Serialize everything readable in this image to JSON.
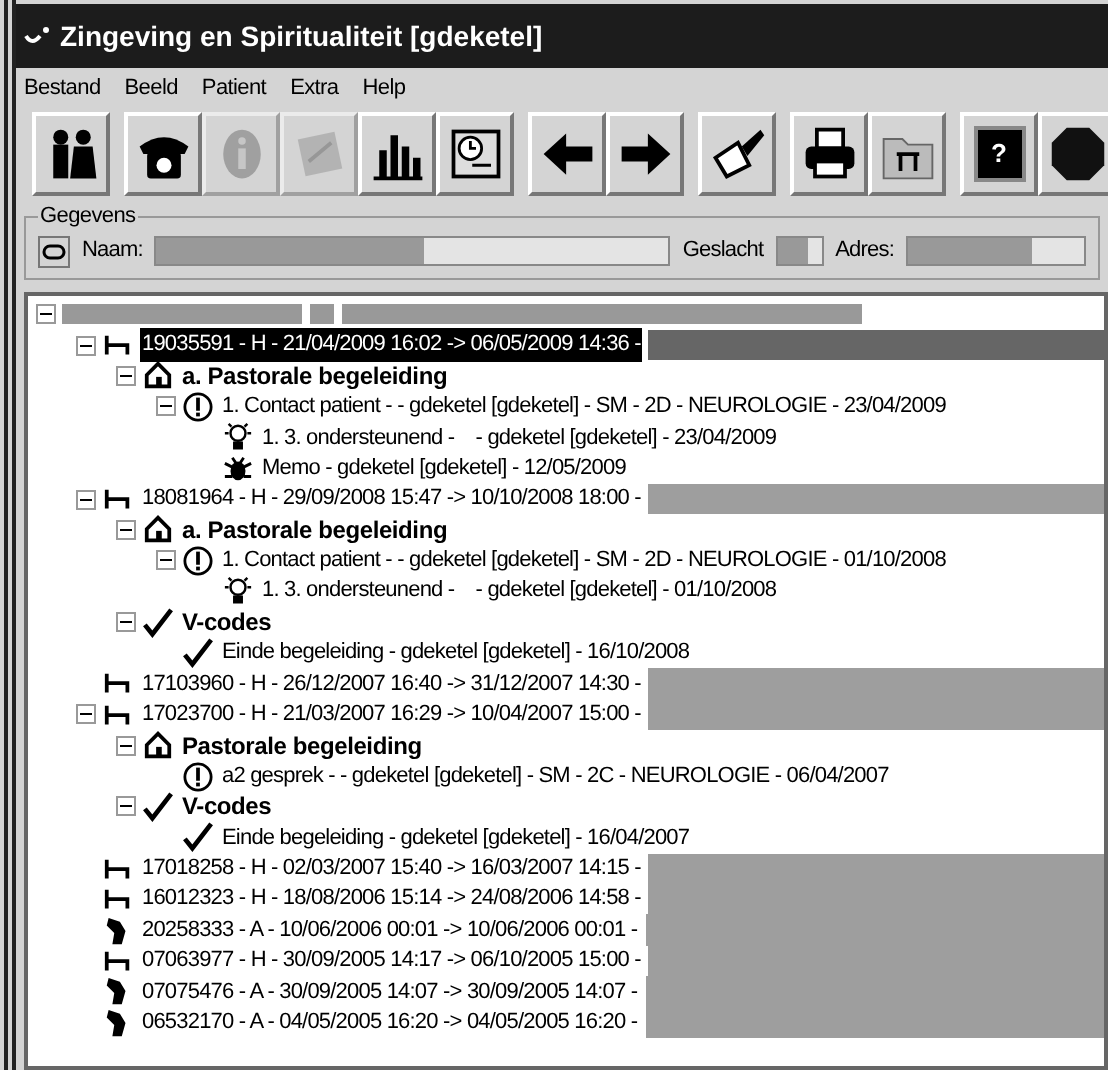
{
  "window": {
    "title": "Zingeving en Spiritualiteit [gdeketel]"
  },
  "menu": [
    "Bestand",
    "Beeld",
    "Patient",
    "Extra",
    "Help"
  ],
  "toolbar": [
    [
      {
        "kind": "people",
        "disabled": false
      }
    ],
    [
      {
        "kind": "phone",
        "disabled": false
      },
      {
        "kind": "info",
        "disabled": true
      },
      {
        "kind": "edit",
        "disabled": true
      },
      {
        "kind": "chart",
        "disabled": false
      },
      {
        "kind": "clock",
        "disabled": false
      }
    ],
    [
      {
        "kind": "back",
        "disabled": false
      },
      {
        "kind": "forward",
        "disabled": false
      }
    ],
    [
      {
        "kind": "brush",
        "disabled": false
      }
    ],
    [
      {
        "kind": "printer",
        "disabled": false
      },
      {
        "kind": "folder",
        "disabled": false
      }
    ],
    [
      {
        "kind": "help",
        "disabled": false,
        "glyph": "?"
      },
      {
        "kind": "stop",
        "disabled": false
      }
    ]
  ],
  "details": {
    "title": "Gegevens",
    "fields": [
      {
        "kind": "name",
        "label": "Naam:"
      },
      {
        "kind": "gender",
        "label": "Geslacht"
      },
      {
        "kind": "address",
        "label": "Adres:"
      }
    ]
  },
  "tree": [
    {
      "kind": "patient",
      "expanded": true,
      "selected": false,
      "children": [
        {
          "kind": "admission",
          "label": "19035591 - H - 21/04/2009 16:02 -> 06/05/2009 14:36 -",
          "expanded": true,
          "selected": true,
          "children": [
            {
              "kind": "category",
              "label": "a. Pastorale begeleiding",
              "expanded": true,
              "selected": false,
              "children": [
                {
                  "kind": "contact",
                  "label": "1. Contact patient - - gdeketel [gdeketel] - SM - 2D - NEUROLOGIE - 23/04/2009",
                  "expanded": true,
                  "selected": false,
                  "children": [
                    {
                      "kind": "note",
                      "label": "1. 3. ondersteunend -    - gdeketel [gdeketel] - 23/04/2009",
                      "expanded": false,
                      "selected": false
                    },
                    {
                      "kind": "memo",
                      "label": "Memo - gdeketel [gdeketel] - 12/05/2009",
                      "expanded": false,
                      "selected": false
                    }
                  ]
                }
              ]
            }
          ]
        },
        {
          "kind": "admission",
          "label": "18081964 - H - 29/09/2008 15:47 -> 10/10/2008 18:00 -",
          "expanded": true,
          "selected": false,
          "children": [
            {
              "kind": "category",
              "label": "a. Pastorale begeleiding",
              "expanded": true,
              "selected": false,
              "children": [
                {
                  "kind": "contact",
                  "label": "1. Contact patient - - gdeketel [gdeketel] - SM - 2D - NEUROLOGIE - 01/10/2008",
                  "expanded": true,
                  "selected": false,
                  "children": [
                    {
                      "kind": "note",
                      "label": "1. 3. ondersteunend -    - gdeketel [gdeketel] - 01/10/2008",
                      "expanded": false,
                      "selected": false
                    }
                  ]
                }
              ]
            },
            {
              "kind": "codes",
              "label": "V-codes",
              "expanded": true,
              "selected": false,
              "children": [
                {
                  "kind": "closure",
                  "label": "Einde begeleiding - gdeketel [gdeketel] - 16/10/2008",
                  "expanded": false,
                  "selected": false
                }
              ]
            }
          ]
        },
        {
          "kind": "admission",
          "label": "17103960 - H - 26/12/2007 16:40 -> 31/12/2007 14:30 -",
          "expanded": false,
          "selected": false
        },
        {
          "kind": "admission",
          "label": "17023700 - H - 21/03/2007 16:29 -> 10/04/2007 15:00 -",
          "expanded": true,
          "selected": false,
          "children": [
            {
              "kind": "category",
              "label": "Pastorale begeleiding",
              "expanded": true,
              "selected": false,
              "children": [
                {
                  "kind": "contact",
                  "label": "a2 gesprek - - gdeketel [gdeketel] - SM - 2C - NEUROLOGIE - 06/04/2007",
                  "expanded": false,
                  "selected": false
                }
              ]
            },
            {
              "kind": "codes",
              "label": "V-codes",
              "expanded": true,
              "selected": false,
              "children": [
                {
                  "kind": "closure",
                  "label": "Einde begeleiding - gdeketel [gdeketel] - 16/04/2007",
                  "expanded": false,
                  "selected": false
                }
              ]
            }
          ]
        },
        {
          "kind": "admission",
          "label": "17018258 - H - 02/03/2007 15:40 -> 16/03/2007 14:15 -",
          "expanded": false,
          "selected": false
        },
        {
          "kind": "admission",
          "label": "16012323 - H - 18/08/2006 15:14 -> 24/08/2006 14:58 -",
          "expanded": false,
          "selected": false
        },
        {
          "kind": "outpatient",
          "label": "20258333 - A - 10/06/2006 00:01 -> 10/06/2006 00:01 -",
          "expanded": false,
          "selected": false
        },
        {
          "kind": "admission",
          "label": "07063977 - H - 30/09/2005 14:17 -> 06/10/2005 15:00 -",
          "expanded": false,
          "selected": false
        },
        {
          "kind": "outpatient",
          "label": "07075476 - A - 30/09/2005 14:07 -> 30/09/2005 14:07 -",
          "expanded": false,
          "selected": false
        },
        {
          "kind": "outpatient",
          "label": "06532170 - A - 04/05/2005 16:20 -> 04/05/2005 16:20 -",
          "expanded": false,
          "selected": false
        }
      ]
    }
  ]
}
